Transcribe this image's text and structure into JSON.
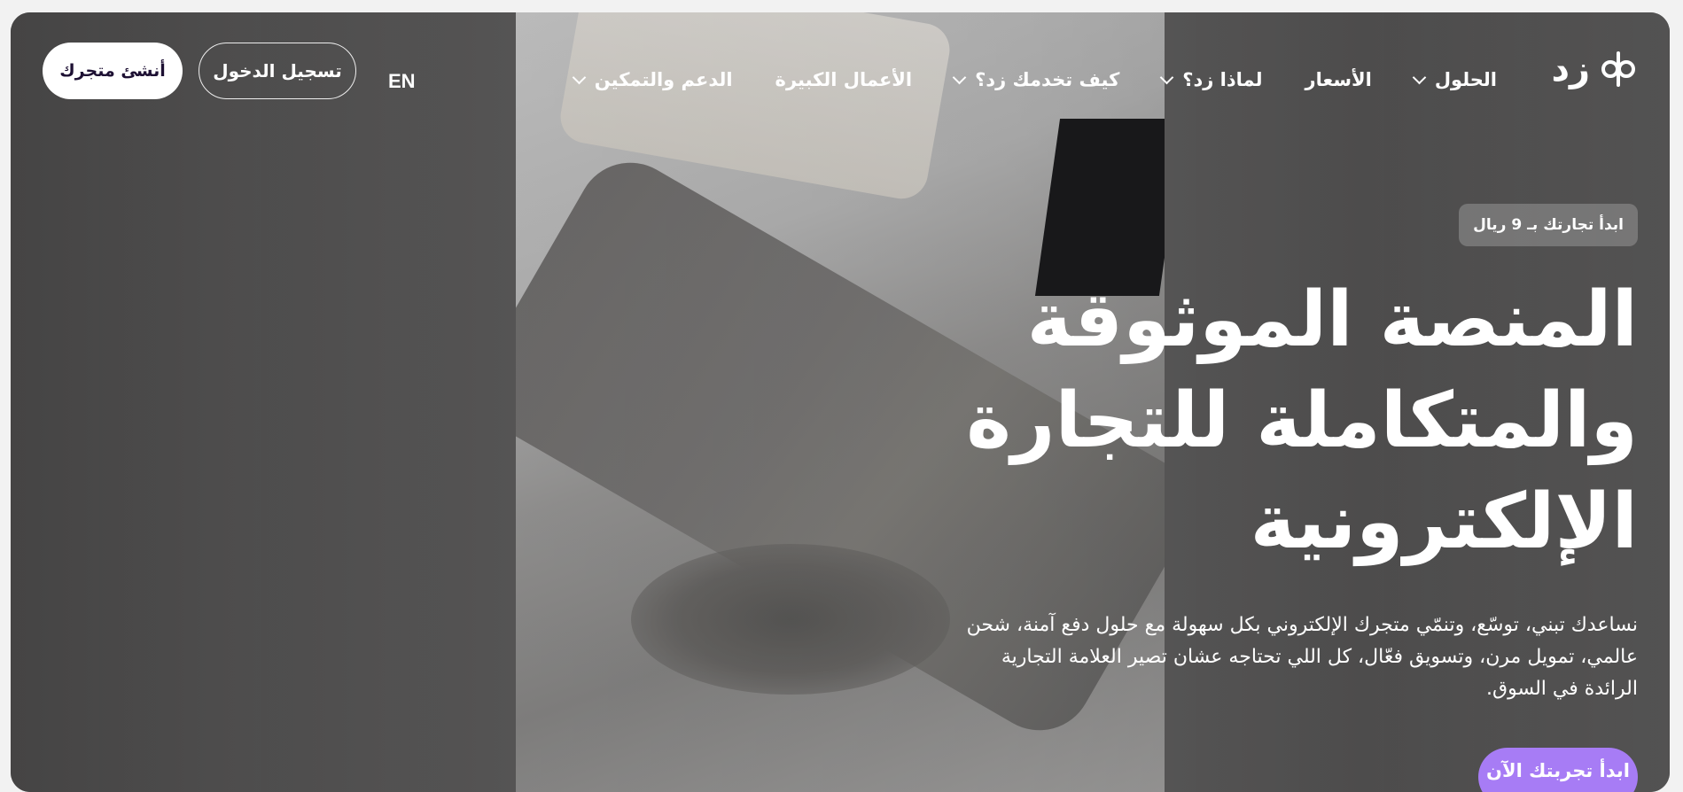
{
  "brand": {
    "logo_text": "زد",
    "logo_icon": "zid-knot-icon"
  },
  "nav": {
    "items": [
      {
        "label": "الحلول",
        "has_dropdown": true
      },
      {
        "label": "الأسعار",
        "has_dropdown": false
      },
      {
        "label": "لماذا زد؟",
        "has_dropdown": true
      },
      {
        "label": "كيف تخدمك زد؟",
        "has_dropdown": true
      },
      {
        "label": "الأعمال الكبيرة",
        "has_dropdown": false
      },
      {
        "label": "الدعم والتمكين",
        "has_dropdown": true
      }
    ],
    "lang_toggle": "EN",
    "login_label": "تسجيل الدخول",
    "create_store_label": "أنشئ متجرك"
  },
  "hero": {
    "badge": "ابدأ تجارتك بـ 9 ريال",
    "title_lines": [
      "المنصة الموثوقة",
      "والمتكاملة للتجارة",
      "الإلكترونية"
    ],
    "description": "نساعدك تبني، توسّع، وتنمّي متجرك الإلكتروني بكل سهولة مع حلول دفع آمنة، شحن عالمي، تمويل مرن، وتسويق فعّال، كل اللي تحتاجه عشان تصير العلامة التجارية الرائدة في السوق.",
    "cta_label": "ابدأ تجربتك الآن"
  },
  "colors": {
    "accent": "#a77cf5",
    "create_button_text": "#1d1033"
  }
}
